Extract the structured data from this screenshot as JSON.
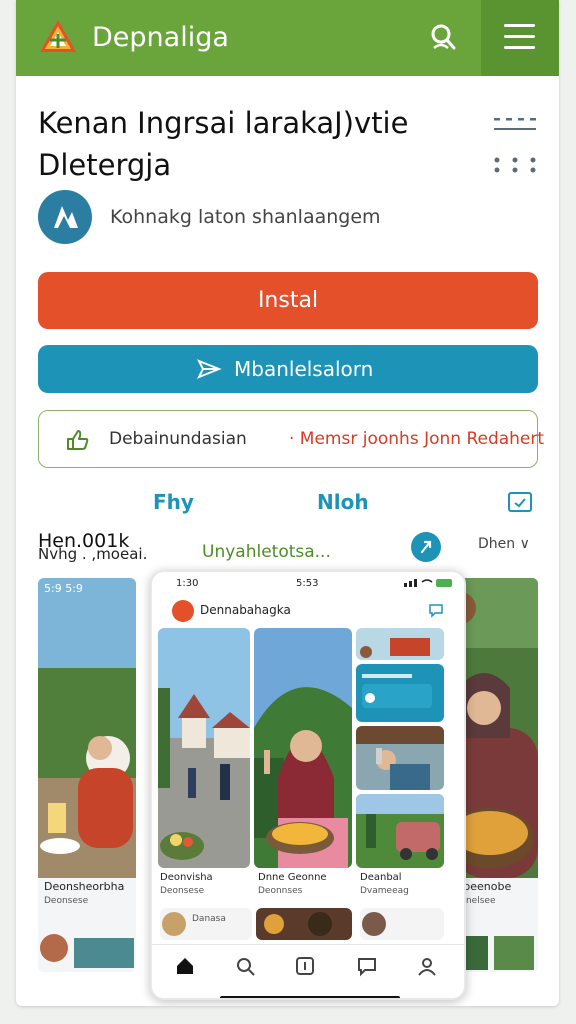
{
  "app_bar": {
    "title": "Depnaliga",
    "search_icon": "search-icon",
    "menu_icon": "hamburger-menu-icon",
    "color": "#6aa53c"
  },
  "app": {
    "title_line1": "Kenan Ingrsai larakaJ)vtie",
    "title_line2": "Dletergja",
    "developer": "Kohnakg laton shanlaangem"
  },
  "actions": {
    "install_label": "Instal",
    "secondary_label": "Mbanlelsalorn",
    "install_color": "#e3502a",
    "secondary_color": "#1d93b8"
  },
  "notice": {
    "text_main": "Debainundasian",
    "text_highlight": "· Memsr joonhs Jonn Redahert"
  },
  "tabs": [
    {
      "label": "Fhy"
    },
    {
      "label": "Nloh"
    }
  ],
  "section": {
    "title": "Hen.001k",
    "subtitle_left": "Nvhg .  ,moeai.",
    "subtitle_right": "Unyahletotsa...",
    "sort_label": "Dhen"
  },
  "screenshot_phone": {
    "status_time": "1:30",
    "status_mid": "5:53",
    "header_title": "Dennabahagka",
    "captions": [
      {
        "title": "Deonvisha",
        "sub": "Deonsese"
      },
      {
        "title": "Dnne Geonne",
        "sub": "Deonnses"
      },
      {
        "title": "Deanbal",
        "sub": "Dvameeag"
      }
    ],
    "bottom_cards": [
      "Danasa",
      "",
      ""
    ],
    "nav": [
      "home-icon",
      "search-icon",
      "bookmark-icon",
      "chat-icon",
      "profile-icon"
    ]
  },
  "side_shots": {
    "left_top": "5:9 5:9",
    "left_caption": "Deonsheorbha",
    "left_caption_sub": "Deonsese",
    "right_caption": "Debeenobe",
    "right_caption_sub": "Deonelsee"
  }
}
